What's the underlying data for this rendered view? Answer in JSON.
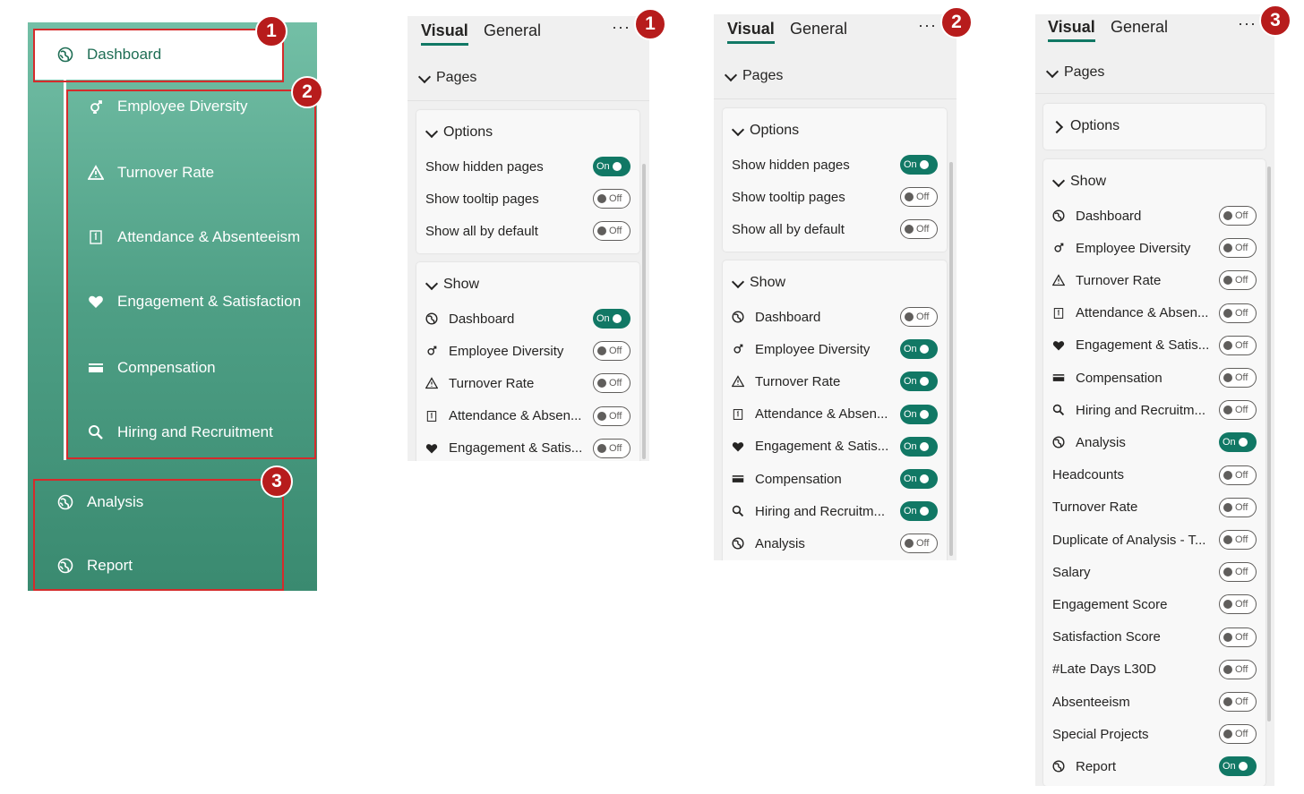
{
  "nav": {
    "items": [
      {
        "label": "Dashboard",
        "icon": "globe-icon"
      },
      {
        "label": "Employee Diversity",
        "icon": "gender-icon"
      },
      {
        "label": "Turnover Rate",
        "icon": "warning-icon"
      },
      {
        "label": "Attendance & Absenteeism",
        "icon": "calendar-icon"
      },
      {
        "label": "Engagement & Satisfaction",
        "icon": "heart-icon"
      },
      {
        "label": "Compensation",
        "icon": "card-icon"
      },
      {
        "label": "Hiring and Recruitment",
        "icon": "search-icon"
      },
      {
        "label": "Analysis",
        "icon": "globe-icon"
      },
      {
        "label": "Report",
        "icon": "globe-icon"
      }
    ],
    "badges": [
      "1",
      "2",
      "3"
    ],
    "colors": {
      "gradient_top": "#73bfa6",
      "gradient_bottom": "#3a8a70",
      "highlight": "#d52b2b",
      "badge": "#b71c1c"
    }
  },
  "panes": {
    "tabs": {
      "visual": "Visual",
      "general": "General",
      "more": "···"
    },
    "pages_label": "Pages",
    "options_label": "Options",
    "show_label": "Show",
    "on": "On",
    "off": "Off",
    "option_rows": [
      "Show hidden pages",
      "Show tooltip pages",
      "Show all by default"
    ],
    "pane1": {
      "badge": "1",
      "options": [
        true,
        false,
        false
      ],
      "show": [
        {
          "label": "Dashboard",
          "icon": "globe-icon",
          "on": true
        },
        {
          "label": "Employee Diversity",
          "icon": "gender-icon",
          "on": false
        },
        {
          "label": "Turnover Rate",
          "icon": "warning-icon",
          "on": false
        },
        {
          "label": "Attendance & Absen...",
          "icon": "calendar-icon",
          "on": false
        },
        {
          "label": "Engagement & Satis...",
          "icon": "heart-icon",
          "on": false
        }
      ]
    },
    "pane2": {
      "badge": "2",
      "options": [
        true,
        false,
        false
      ],
      "show": [
        {
          "label": "Dashboard",
          "icon": "globe-icon",
          "on": false
        },
        {
          "label": "Employee Diversity",
          "icon": "gender-icon",
          "on": true
        },
        {
          "label": "Turnover Rate",
          "icon": "warning-icon",
          "on": true
        },
        {
          "label": "Attendance & Absen...",
          "icon": "calendar-icon",
          "on": true
        },
        {
          "label": "Engagement & Satis...",
          "icon": "heart-icon",
          "on": true
        },
        {
          "label": "Compensation",
          "icon": "card-icon",
          "on": true
        },
        {
          "label": "Hiring and Recruitm...",
          "icon": "search-icon",
          "on": true
        },
        {
          "label": "Analysis",
          "icon": "globe-icon",
          "on": false
        }
      ]
    },
    "pane3": {
      "badge": "3",
      "show": [
        {
          "label": "Dashboard",
          "icon": "globe-icon",
          "on": false
        },
        {
          "label": "Employee Diversity",
          "icon": "gender-icon",
          "on": false
        },
        {
          "label": "Turnover Rate",
          "icon": "warning-icon",
          "on": false
        },
        {
          "label": "Attendance & Absen...",
          "icon": "calendar-icon",
          "on": false
        },
        {
          "label": "Engagement & Satis...",
          "icon": "heart-icon",
          "on": false
        },
        {
          "label": "Compensation",
          "icon": "card-icon",
          "on": false
        },
        {
          "label": "Hiring and Recruitm...",
          "icon": "search-icon",
          "on": false
        },
        {
          "label": "Analysis",
          "icon": "globe-icon",
          "on": true
        },
        {
          "label": "Headcounts",
          "icon": "",
          "on": false
        },
        {
          "label": "Turnover Rate",
          "icon": "",
          "on": false
        },
        {
          "label": "Duplicate of Analysis - T...",
          "icon": "",
          "on": false
        },
        {
          "label": "Salary",
          "icon": "",
          "on": false
        },
        {
          "label": "Engagement Score",
          "icon": "",
          "on": false
        },
        {
          "label": "Satisfaction Score",
          "icon": "",
          "on": false
        },
        {
          "label": "#Late Days L30D",
          "icon": "",
          "on": false
        },
        {
          "label": "Absenteeism",
          "icon": "",
          "on": false
        },
        {
          "label": "Special Projects",
          "icon": "",
          "on": false
        },
        {
          "label": "Report",
          "icon": "globe-icon",
          "on": true
        }
      ]
    },
    "colors": {
      "toggle_on": "#117865",
      "toggle_off_border": "#605e5c",
      "pane_bg": "#f0f0f0",
      "card_bg": "#f8f8f8"
    }
  }
}
